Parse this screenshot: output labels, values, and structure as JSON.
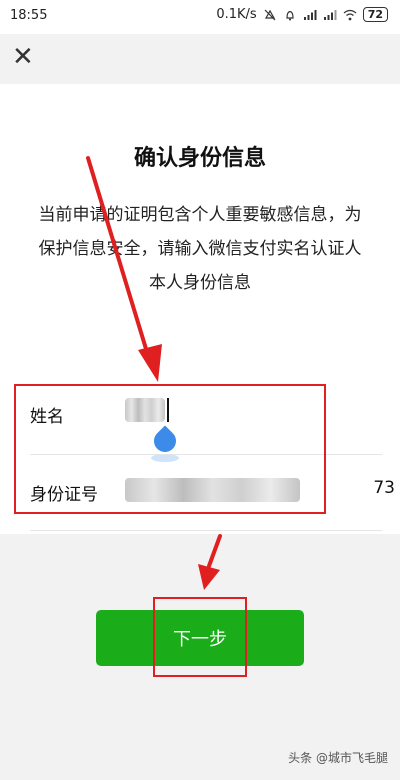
{
  "status_bar": {
    "time": "18:55",
    "network_speed": "0.1K/s",
    "battery": "72"
  },
  "top_bar": {
    "close_icon": "close-icon"
  },
  "dialog": {
    "title": "确认身份信息",
    "description": "当前申请的证明包含个人重要敏感信息，为保护信息安全，请输入微信支付实名认证人本人身份信息"
  },
  "form": {
    "name_label": "姓名",
    "id_label": "身份证号",
    "id_suffix": "73"
  },
  "actions": {
    "next_label": "下一步"
  },
  "watermark": "头条 @城市飞毛腿",
  "colors": {
    "button_green": "#1aad19",
    "annotation_red": "#e02020",
    "handle_blue": "#3c8be8"
  }
}
